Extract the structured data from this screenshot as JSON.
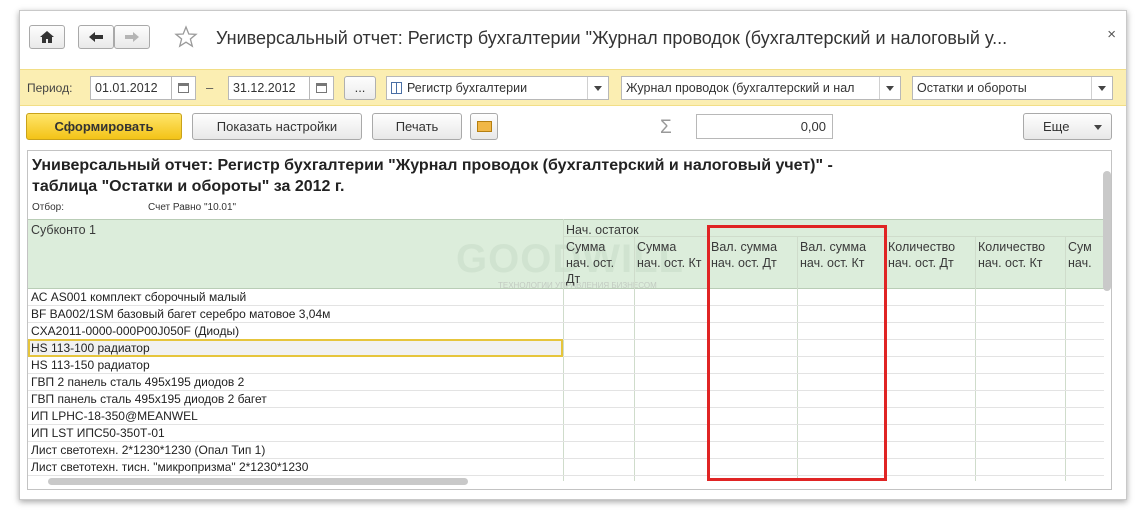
{
  "window": {
    "title": "Универсальный отчет: Регистр бухгалтерии \"Журнал проводок (бухгалтерский и налоговый у...",
    "close": "×"
  },
  "params": {
    "period_label": "Период:",
    "date_from": "01.01.2012",
    "dash": "–",
    "date_to": "31.12.2012",
    "dots": "...",
    "source_type": "Регистр бухгалтерии",
    "register": "Журнал проводок (бухгалтерский и нал",
    "table": "Остатки и обороты"
  },
  "toolbar": {
    "generate": "Сформировать",
    "show_settings": "Показать настройки",
    "print": "Печать",
    "sigma": "Σ",
    "sum_value": "0,00",
    "more": "Еще"
  },
  "report": {
    "title": "Универсальный отчет: Регистр бухгалтерии \"Журнал проводок (бухгалтерский и налоговый учет)\" - таблица \"Остатки и обороты\" за 2012 г.",
    "filter_label": "Отбор:",
    "filter_value": "Счет Равно \"10.01\"",
    "watermark": "GOODWILL",
    "watermark_small": "ТЕХНОЛОГИИ УПРАВЛЕНИЯ БИЗНЕСОМ",
    "columns": {
      "subkonto": "Субконто 1",
      "group_start": "Нач. остаток",
      "c1": "Сумма нач. ост. Дт",
      "c2": "Сумма нач. ост. Кт",
      "c3": "Вал. сумма нач. ост. Дт",
      "c4": "Вал. сумма нач. ост. Кт",
      "c5": "Количество нач. ост. Дт",
      "c6": "Количество нач. ост. Кт",
      "c7": "Сум нач."
    },
    "rows": [
      "АС AS001 комплект сборочный малый",
      "BF BA002/1SM базовый багет серебро матовое 3,04м",
      "CXA2011-0000-000P00J050F (Диоды)",
      "HS 113-100 радиатор",
      "HS 113-150 радиатор",
      "ГВП 2 панель сталь 495x195 диодов 2",
      "ГВП панель сталь 495x195 диодов 2 багет",
      "ИП LPHC-18-350@MEANWEL",
      "ИП LST ИПС50-350Т-01",
      "Лист светотехн. 2*1230*1230 (Опал Тип 1)",
      "Лист светотехн. тисн. \"микропризма\" 2*1230*1230"
    ]
  }
}
